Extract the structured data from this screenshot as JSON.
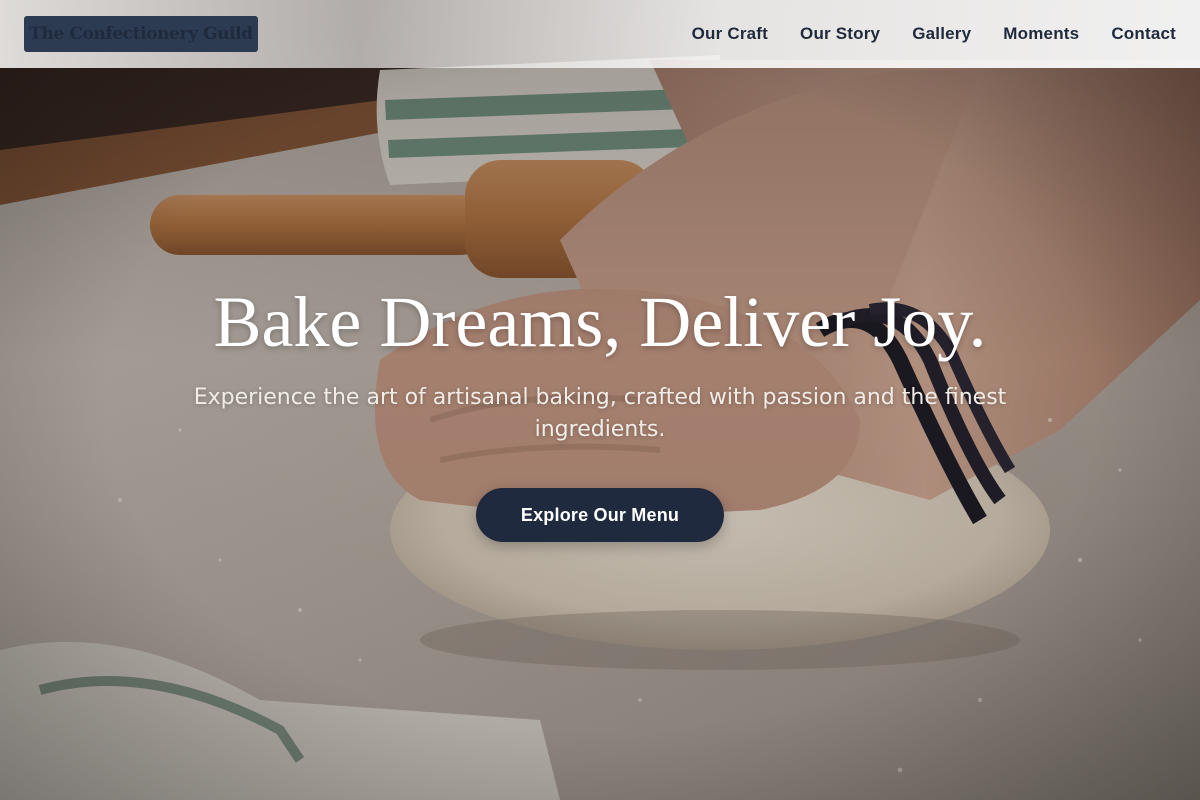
{
  "header": {
    "logo_text": "The Confectionery Guild",
    "nav": [
      {
        "label": "Our Craft"
      },
      {
        "label": "Our Story"
      },
      {
        "label": "Gallery"
      },
      {
        "label": "Moments"
      },
      {
        "label": "Contact"
      }
    ]
  },
  "hero": {
    "title": "Bake Dreams, Deliver Joy.",
    "subtitle": "Experience the art of artisanal baking, crafted with passion and the finest ingredients.",
    "cta_label": "Explore Our Menu",
    "background_description_icon": "kneading-dough-image"
  },
  "colors": {
    "brand_navy": "#1f2a3f",
    "logo_bg": "#2c3a52",
    "nav_text": "#1f2a3c",
    "hero_text": "#ffffff"
  }
}
